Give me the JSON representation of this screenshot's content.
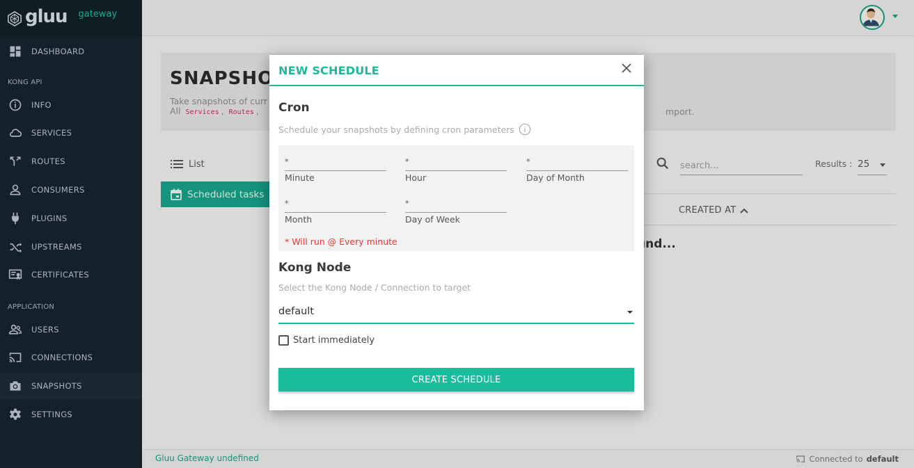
{
  "brand": {
    "name": "gluu",
    "product": "gateway"
  },
  "sidebar": {
    "sections": {
      "kong_api": "KONG API",
      "application": "APPLICATION"
    },
    "items": [
      {
        "label": "DASHBOARD"
      },
      {
        "label": "INFO"
      },
      {
        "label": "SERVICES"
      },
      {
        "label": "ROUTES"
      },
      {
        "label": "CONSUMERS"
      },
      {
        "label": "PLUGINS"
      },
      {
        "label": "UPSTREAMS"
      },
      {
        "label": "CERTIFICATES"
      },
      {
        "label": "USERS"
      },
      {
        "label": "CONNECTIONS"
      },
      {
        "label": "SNAPSHOTS"
      },
      {
        "label": "SETTINGS"
      }
    ],
    "active": "SNAPSHOTS"
  },
  "page": {
    "title": "SNAPSHOT",
    "desc_line1": "Take snapshots of curr",
    "desc_line2_prefix": "All",
    "code_services": "Services",
    "code_routes": "Routes",
    "desc_suffix": "mport.",
    "list_label": "List",
    "scheduled_tasks_label": "Scheduled tasks",
    "search_placeholder": "search...",
    "results_label": "Results :",
    "results_value": "25",
    "created_at_header": "CREATED AT",
    "found_text": "und..."
  },
  "footer": {
    "left": "Gluu Gateway undefined",
    "connected_prefix": "Connected to",
    "connected_target": "default"
  },
  "modal": {
    "title": "NEW SCHEDULE",
    "cron": {
      "title": "Cron",
      "description": "Schedule your snapshots by defining cron parameters",
      "fields": {
        "minute": {
          "label": "Minute",
          "value": "*"
        },
        "hour": {
          "label": "Hour",
          "value": "*"
        },
        "day_of_month": {
          "label": "Day of Month",
          "value": "*"
        },
        "month": {
          "label": "Month",
          "value": "*"
        },
        "day_of_week": {
          "label": "Day of Week",
          "value": "*"
        }
      },
      "summary": "* Will run @ Every minute"
    },
    "kong_node": {
      "title": "Kong Node",
      "description": "Select the Kong Node / Connection to target",
      "selected": "default"
    },
    "start_immediately_label": "Start immediately",
    "start_immediately_checked": false,
    "create_label": "CREATE SCHEDULE"
  },
  "colors": {
    "accent": "#1abc9c",
    "sidebar_bg": "#16232e",
    "error": "#e53935"
  }
}
